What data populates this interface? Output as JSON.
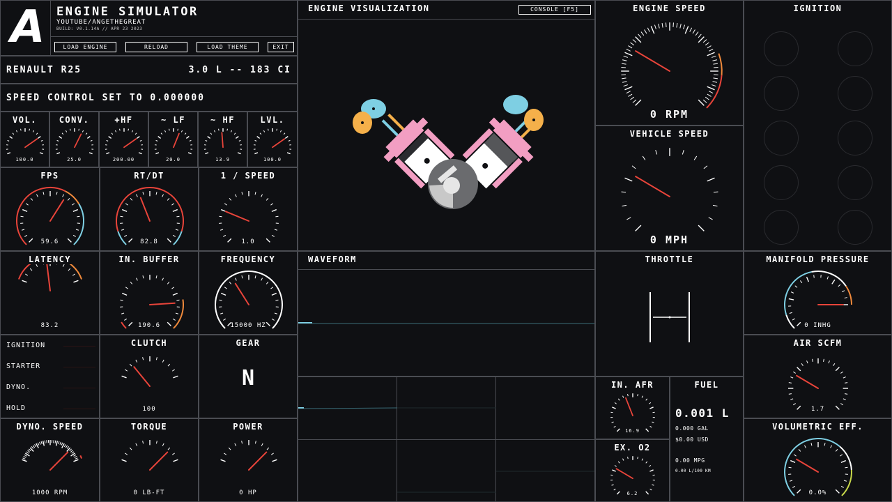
{
  "header": {
    "logo": "A",
    "title": "ENGINE SIMULATOR",
    "subtitle": "YOUTUBE/ANGETHEGREAT",
    "build": "BUILD: V0.1.14A // APR 23 2023",
    "buttons": [
      "LOAD ENGINE",
      "RELOAD",
      "LOAD THEME",
      "EXIT"
    ]
  },
  "engine": {
    "name": "RENAULT R25",
    "displacement": "3.0 L -- 183 CI"
  },
  "speed_control": "SPEED CONTROL SET TO 0.000000",
  "colors": {
    "bg": "#0f1013",
    "border": "#4a4c52",
    "needle": "#e8443a",
    "orange": "#f08a3c",
    "blue": "#7ecfe3",
    "yellow": "#c8d84a",
    "pink": "#f29ec2",
    "piston_orange": "#f5b04a"
  },
  "small_gauges": [
    {
      "title": "VOL.",
      "value": "100.0",
      "fraction": 0.75
    },
    {
      "title": "CONV.",
      "value": "25.0",
      "fraction": 0.62
    },
    {
      "title": "+HF",
      "value": "200.00",
      "fraction": 0.75
    },
    {
      "title": "~ LF",
      "value": "20.0",
      "fraction": 0.6
    },
    {
      "title": "~ HF",
      "value": "13.9",
      "fraction": 0.48
    },
    {
      "title": "LVL.",
      "value": "100.0",
      "fraction": 0.75
    }
  ],
  "fps": {
    "title": "FPS",
    "value": "59.6",
    "fraction": 0.62
  },
  "rtdt": {
    "title": "RT/DT",
    "value": "82.8",
    "fraction": 0.42
  },
  "inv_speed": {
    "title": "1 / SPEED",
    "value": "1.0",
    "fraction": 0.25
  },
  "latency": {
    "title": "LATENCY",
    "value": "83.2",
    "fraction": 0.45
  },
  "in_buffer": {
    "title": "IN. BUFFER",
    "value": "190.6",
    "fraction": 0.82
  },
  "frequency": {
    "title": "FREQUENCY",
    "value": "15000 HZ",
    "fraction": 0.38
  },
  "signals": [
    "IGNITION",
    "STARTER",
    "DYNO.",
    "HOLD"
  ],
  "clutch": {
    "title": "CLUTCH",
    "value": "100",
    "fraction": 0.22
  },
  "gear": {
    "title": "GEAR",
    "value": "N"
  },
  "dyno_speed": {
    "title": "DYNO. SPEED",
    "value": "1000 RPM",
    "fraction": 0.82
  },
  "torque": {
    "title": "TORQUE",
    "value": "0 LB-FT",
    "fraction": 0.82
  },
  "power": {
    "title": "POWER",
    "value": "0 HP",
    "fraction": 0.82
  },
  "visualization": {
    "title": "ENGINE VISUALIZATION",
    "console": "CONSOLE [F5]"
  },
  "waveform": {
    "title": "WAVEFORM"
  },
  "engine_speed": {
    "title": "ENGINE SPEED",
    "value": "0 RPM",
    "fraction": 0.28
  },
  "vehicle_speed": {
    "title": "VEHICLE SPEED",
    "value": "0 MPH",
    "fraction": 0.28
  },
  "ignition_title": "IGNITION",
  "throttle": {
    "title": "THROTTLE"
  },
  "manifold": {
    "title": "MANIFOLD PRESSURE",
    "value": "0 INHG",
    "fraction": 1.0
  },
  "air_scfm": {
    "title": "AIR SCFM",
    "value": "1.7",
    "fraction": 0.28
  },
  "in_afr": {
    "title": "IN. AFR",
    "value": "16.9",
    "fraction": 0.42
  },
  "ex_o2": {
    "title": "EX. O2",
    "value": "6.2",
    "fraction": 0.28
  },
  "fuel": {
    "title": "FUEL",
    "liters": "0.001 L",
    "gallons": "0.000 GAL",
    "cost": "$0.00 USD",
    "mpg": "0.00 MPG",
    "lper100": "0.00 L/100 KM"
  },
  "vol_eff": {
    "title": "VOLUMETRIC EFF.",
    "value": "0.0%",
    "fraction": 0.28
  }
}
